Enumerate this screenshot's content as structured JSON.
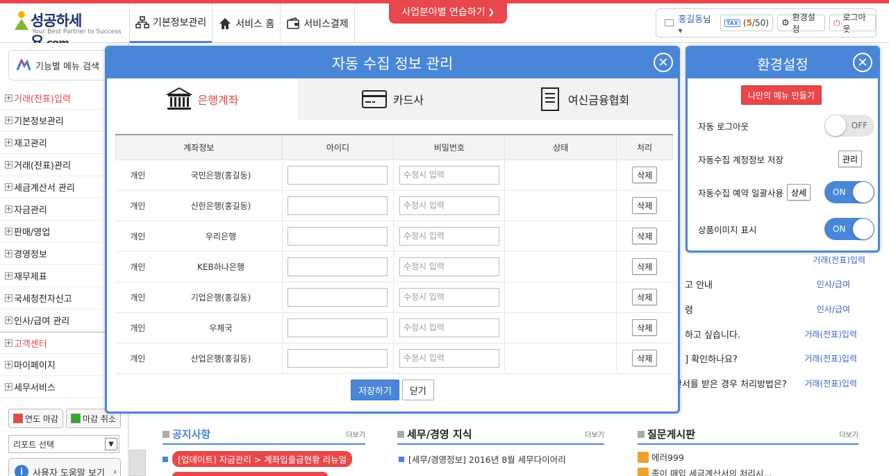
{
  "header": {
    "brand_main": "성공",
    "brand_rest": "하세요",
    "brand_domain": ".com",
    "tagline": "Your Best Partner to Success",
    "nav": [
      {
        "label": "기본정보관리"
      },
      {
        "label": "서비스 홈"
      },
      {
        "label": "서비스결제"
      }
    ],
    "practice_button": "사업분야별 연습하기",
    "user": {
      "name": "홍길동",
      "suffix": "님",
      "tax_icon": "TAX",
      "tax_open": "(",
      "tax_used": "5",
      "tax_total": "/50)",
      "settings_label": "환경설정",
      "logout_label": "로그아웃"
    }
  },
  "sidebar": {
    "search_label": "기능별 메뉴 검색",
    "items": [
      {
        "label": "거래(전표)입력"
      },
      {
        "label": "기본정보관리"
      },
      {
        "label": "재고관리"
      },
      {
        "label": "거래(전표)관리"
      },
      {
        "label": "세금계산서 관리"
      },
      {
        "label": "자금관리"
      },
      {
        "label": "판매/영업"
      },
      {
        "label": "경영정보"
      },
      {
        "label": "재무제표"
      },
      {
        "label": "국세청전자신고"
      },
      {
        "label": "인사/급여 관리"
      },
      {
        "label": "고객센터"
      },
      {
        "label": "마이페이지"
      },
      {
        "label": "세무서비스"
      }
    ],
    "year_close": "연도 마감",
    "close_cancel": "마감 취소",
    "report_select": "리포트 선택",
    "help_label": "사용자 도움말 보기"
  },
  "background": {
    "rows": [
      {
        "text": "",
        "category": "거래(전표)입력"
      },
      {
        "text": "고 안내",
        "category": "인사/급여"
      },
      {
        "text": "령",
        "category": "인사/급여"
      },
      {
        "text": "하고 싶습니다.",
        "category": "거래(전표)입력"
      },
      {
        "text": "] 확인하나요?",
        "category": "거래(전표)입력"
      },
      {
        "text": "ᅨ산서를 받은 경우 처리방법은?",
        "category": "거래(전표)입력"
      }
    ],
    "notice_title": "공지사항",
    "tax_title": "세무/경영 지식",
    "qa_title": "질문게시판",
    "more": "더보기",
    "notice_item": "[업데이트] 자금관리 > 계좌입출금현황 리뉴얼",
    "tax_item": "[세무/경영정보] 2016년 8월 세무다이어리",
    "qa_items": [
      "에러999",
      "종이 매입 세금계산서의 처리시..."
    ]
  },
  "modal": {
    "title": "자동 수집 정보 관리",
    "tabs": [
      {
        "label": "은행계좌"
      },
      {
        "label": "카드사"
      },
      {
        "label": "여신금융협회"
      }
    ],
    "columns": [
      "계좌정보",
      "아이디",
      "비밀번호",
      "상태",
      "처리"
    ],
    "rows": [
      {
        "type": "개인",
        "bank": "국민은행(홍길동)"
      },
      {
        "type": "개인",
        "bank": "신한은행(홍길동)"
      },
      {
        "type": "개인",
        "bank": "우리은행"
      },
      {
        "type": "개인",
        "bank": "KEB하나은행"
      },
      {
        "type": "개인",
        "bank": "기업은행(홍길동)"
      },
      {
        "type": "개인",
        "bank": "우체국"
      },
      {
        "type": "개인",
        "bank": "산업은행(홍길동)"
      }
    ],
    "password_placeholder": "수정시 입력",
    "delete_label": "삭제",
    "save_label": "저장하기",
    "close_label": "닫기"
  },
  "settings": {
    "title": "환경설정",
    "my_menu_button": "나만의 메뉴 만들기",
    "auto_logout": {
      "label": "자동 로그아웃",
      "state": "OFF"
    },
    "save_account": {
      "label": "자동수집 계정정보 저장",
      "button": "관리"
    },
    "bulk_reserve": {
      "label": "자동수집 예약 일괄사용",
      "button": "상세",
      "state": "ON"
    },
    "product_image": {
      "label": "상품이미지 표시",
      "state": "ON"
    }
  },
  "colors": {
    "accent": "#4a86d8",
    "brand_red": "#e8474b"
  }
}
